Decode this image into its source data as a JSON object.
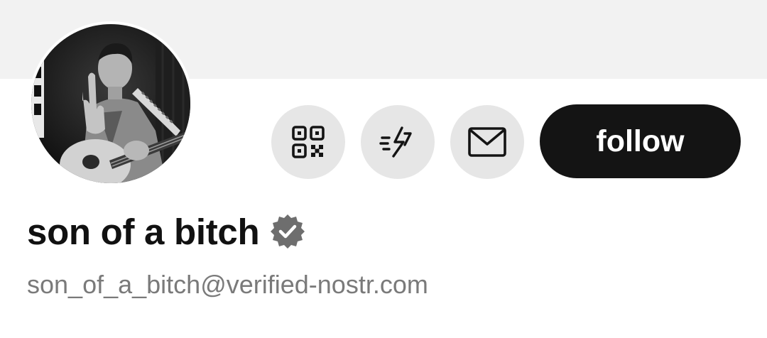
{
  "banner": {
    "color": "#f2f2f2"
  },
  "profile": {
    "display_name": "son of a bitch",
    "nip05": "son_of_a_bitch@verified-nostr.com",
    "verified": true
  },
  "actions": {
    "qr_icon": "qr-code-icon",
    "zap_icon": "lightning-bolt-icon",
    "message_icon": "envelope-icon",
    "follow_label": "follow"
  },
  "colors": {
    "follow_bg": "#141414",
    "icon_button_bg": "#e6e6e6",
    "name": "#111111",
    "nip05": "#7a7a7a",
    "badge": "#6e6e6e"
  }
}
